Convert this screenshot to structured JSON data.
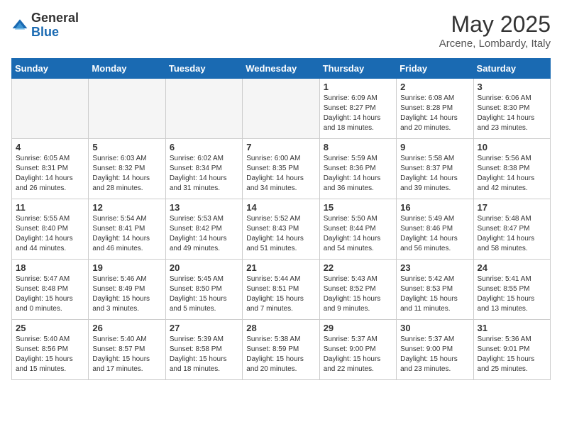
{
  "logo": {
    "general": "General",
    "blue": "Blue"
  },
  "header": {
    "month": "May 2025",
    "location": "Arcene, Lombardy, Italy"
  },
  "weekdays": [
    "Sunday",
    "Monday",
    "Tuesday",
    "Wednesday",
    "Thursday",
    "Friday",
    "Saturday"
  ],
  "weeks": [
    [
      {
        "day": "",
        "info": ""
      },
      {
        "day": "",
        "info": ""
      },
      {
        "day": "",
        "info": ""
      },
      {
        "day": "",
        "info": ""
      },
      {
        "day": "1",
        "info": "Sunrise: 6:09 AM\nSunset: 8:27 PM\nDaylight: 14 hours\nand 18 minutes."
      },
      {
        "day": "2",
        "info": "Sunrise: 6:08 AM\nSunset: 8:28 PM\nDaylight: 14 hours\nand 20 minutes."
      },
      {
        "day": "3",
        "info": "Sunrise: 6:06 AM\nSunset: 8:30 PM\nDaylight: 14 hours\nand 23 minutes."
      }
    ],
    [
      {
        "day": "4",
        "info": "Sunrise: 6:05 AM\nSunset: 8:31 PM\nDaylight: 14 hours\nand 26 minutes."
      },
      {
        "day": "5",
        "info": "Sunrise: 6:03 AM\nSunset: 8:32 PM\nDaylight: 14 hours\nand 28 minutes."
      },
      {
        "day": "6",
        "info": "Sunrise: 6:02 AM\nSunset: 8:34 PM\nDaylight: 14 hours\nand 31 minutes."
      },
      {
        "day": "7",
        "info": "Sunrise: 6:00 AM\nSunset: 8:35 PM\nDaylight: 14 hours\nand 34 minutes."
      },
      {
        "day": "8",
        "info": "Sunrise: 5:59 AM\nSunset: 8:36 PM\nDaylight: 14 hours\nand 36 minutes."
      },
      {
        "day": "9",
        "info": "Sunrise: 5:58 AM\nSunset: 8:37 PM\nDaylight: 14 hours\nand 39 minutes."
      },
      {
        "day": "10",
        "info": "Sunrise: 5:56 AM\nSunset: 8:38 PM\nDaylight: 14 hours\nand 42 minutes."
      }
    ],
    [
      {
        "day": "11",
        "info": "Sunrise: 5:55 AM\nSunset: 8:40 PM\nDaylight: 14 hours\nand 44 minutes."
      },
      {
        "day": "12",
        "info": "Sunrise: 5:54 AM\nSunset: 8:41 PM\nDaylight: 14 hours\nand 46 minutes."
      },
      {
        "day": "13",
        "info": "Sunrise: 5:53 AM\nSunset: 8:42 PM\nDaylight: 14 hours\nand 49 minutes."
      },
      {
        "day": "14",
        "info": "Sunrise: 5:52 AM\nSunset: 8:43 PM\nDaylight: 14 hours\nand 51 minutes."
      },
      {
        "day": "15",
        "info": "Sunrise: 5:50 AM\nSunset: 8:44 PM\nDaylight: 14 hours\nand 54 minutes."
      },
      {
        "day": "16",
        "info": "Sunrise: 5:49 AM\nSunset: 8:46 PM\nDaylight: 14 hours\nand 56 minutes."
      },
      {
        "day": "17",
        "info": "Sunrise: 5:48 AM\nSunset: 8:47 PM\nDaylight: 14 hours\nand 58 minutes."
      }
    ],
    [
      {
        "day": "18",
        "info": "Sunrise: 5:47 AM\nSunset: 8:48 PM\nDaylight: 15 hours\nand 0 minutes."
      },
      {
        "day": "19",
        "info": "Sunrise: 5:46 AM\nSunset: 8:49 PM\nDaylight: 15 hours\nand 3 minutes."
      },
      {
        "day": "20",
        "info": "Sunrise: 5:45 AM\nSunset: 8:50 PM\nDaylight: 15 hours\nand 5 minutes."
      },
      {
        "day": "21",
        "info": "Sunrise: 5:44 AM\nSunset: 8:51 PM\nDaylight: 15 hours\nand 7 minutes."
      },
      {
        "day": "22",
        "info": "Sunrise: 5:43 AM\nSunset: 8:52 PM\nDaylight: 15 hours\nand 9 minutes."
      },
      {
        "day": "23",
        "info": "Sunrise: 5:42 AM\nSunset: 8:53 PM\nDaylight: 15 hours\nand 11 minutes."
      },
      {
        "day": "24",
        "info": "Sunrise: 5:41 AM\nSunset: 8:55 PM\nDaylight: 15 hours\nand 13 minutes."
      }
    ],
    [
      {
        "day": "25",
        "info": "Sunrise: 5:40 AM\nSunset: 8:56 PM\nDaylight: 15 hours\nand 15 minutes."
      },
      {
        "day": "26",
        "info": "Sunrise: 5:40 AM\nSunset: 8:57 PM\nDaylight: 15 hours\nand 17 minutes."
      },
      {
        "day": "27",
        "info": "Sunrise: 5:39 AM\nSunset: 8:58 PM\nDaylight: 15 hours\nand 18 minutes."
      },
      {
        "day": "28",
        "info": "Sunrise: 5:38 AM\nSunset: 8:59 PM\nDaylight: 15 hours\nand 20 minutes."
      },
      {
        "day": "29",
        "info": "Sunrise: 5:37 AM\nSunset: 9:00 PM\nDaylight: 15 hours\nand 22 minutes."
      },
      {
        "day": "30",
        "info": "Sunrise: 5:37 AM\nSunset: 9:00 PM\nDaylight: 15 hours\nand 23 minutes."
      },
      {
        "day": "31",
        "info": "Sunrise: 5:36 AM\nSunset: 9:01 PM\nDaylight: 15 hours\nand 25 minutes."
      }
    ]
  ]
}
